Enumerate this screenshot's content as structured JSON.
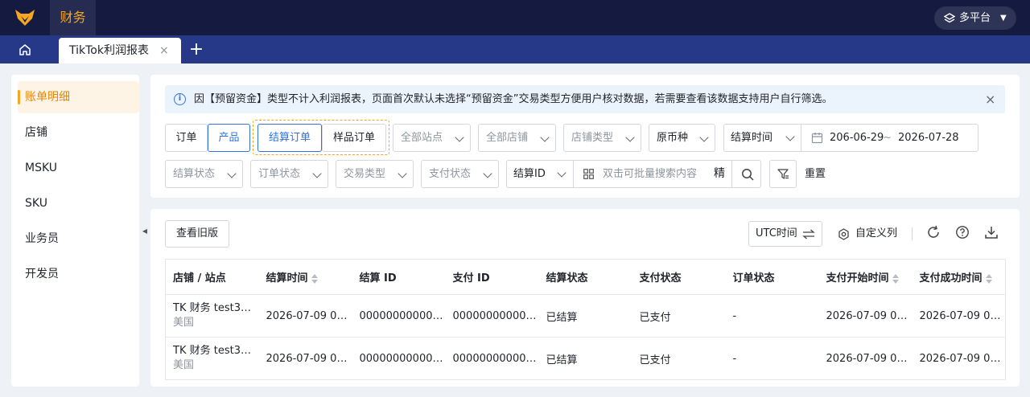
{
  "header": {
    "module": "财务",
    "platform": "多平台"
  },
  "tabs": {
    "active": "TikTok利润报表",
    "close": "×",
    "add": "+"
  },
  "sidebar": {
    "items": [
      {
        "label": "账单明细"
      },
      {
        "label": "店铺"
      },
      {
        "label": "MSKU"
      },
      {
        "label": "SKU"
      },
      {
        "label": "业务员"
      },
      {
        "label": "开发员"
      }
    ]
  },
  "notice": {
    "text": "因【预留资金】类型不计入利润报表，页面首次默认未选择“预留资金”交易类型方便用户核对数据，若需要查看该数据支持用户自行筛选。",
    "close": "×"
  },
  "filters": {
    "dim_order": "订单",
    "dim_product": "产品",
    "type_settle": "结算订单",
    "type_sample": "样品订单",
    "all_sites": "全部站点",
    "all_stores": "全部店铺",
    "store_type": "店铺类型",
    "currency": "原币种",
    "date_type": "结算时间",
    "date_start": "206-06-29",
    "date_sep": "~",
    "date_end": "2026-07-28",
    "settle_status": "结算状态",
    "order_status": "订单状态",
    "trade_type": "交易类型",
    "pay_status": "支付状态",
    "search_type": "结算ID",
    "search_placeholder": "双击可批量搜索内容",
    "precise": "精",
    "reset": "重置"
  },
  "toolbar": {
    "old_version": "查看旧版",
    "utc": "UTC时间",
    "custom_columns": "自定义列"
  },
  "table": {
    "columns": [
      "店铺 / 站点",
      "结算时间",
      "结算 ID",
      "支付 ID",
      "结算状态",
      "支付状态",
      "订单状态",
      "支付开始时间",
      "支付成功时间"
    ],
    "rows": [
      {
        "store": "TK 财务 test3…",
        "site": "美国",
        "settle_time": "2026-07-09 00:…",
        "settle_id": "00000000000…",
        "pay_id": "00000000000…",
        "settle_status": "已结算",
        "pay_status": "已支付",
        "order_status": "-",
        "pay_start": "2026-07-09 07:…",
        "pay_success": "2026-07-09 07…"
      },
      {
        "store": "TK 财务 test3…",
        "site": "美国",
        "settle_time": "2026-07-09 00:…",
        "settle_id": "00000000000…",
        "pay_id": "00000000000…",
        "settle_status": "已结算",
        "pay_status": "已支付",
        "order_status": "-",
        "pay_start": "2026-07-09 07:…",
        "pay_success": "2026-07-09 07…"
      }
    ]
  },
  "colors": {
    "topbar": "#141a40",
    "tabbar": "#253988",
    "accent": "#f5a623",
    "primary": "#2f73e0"
  }
}
